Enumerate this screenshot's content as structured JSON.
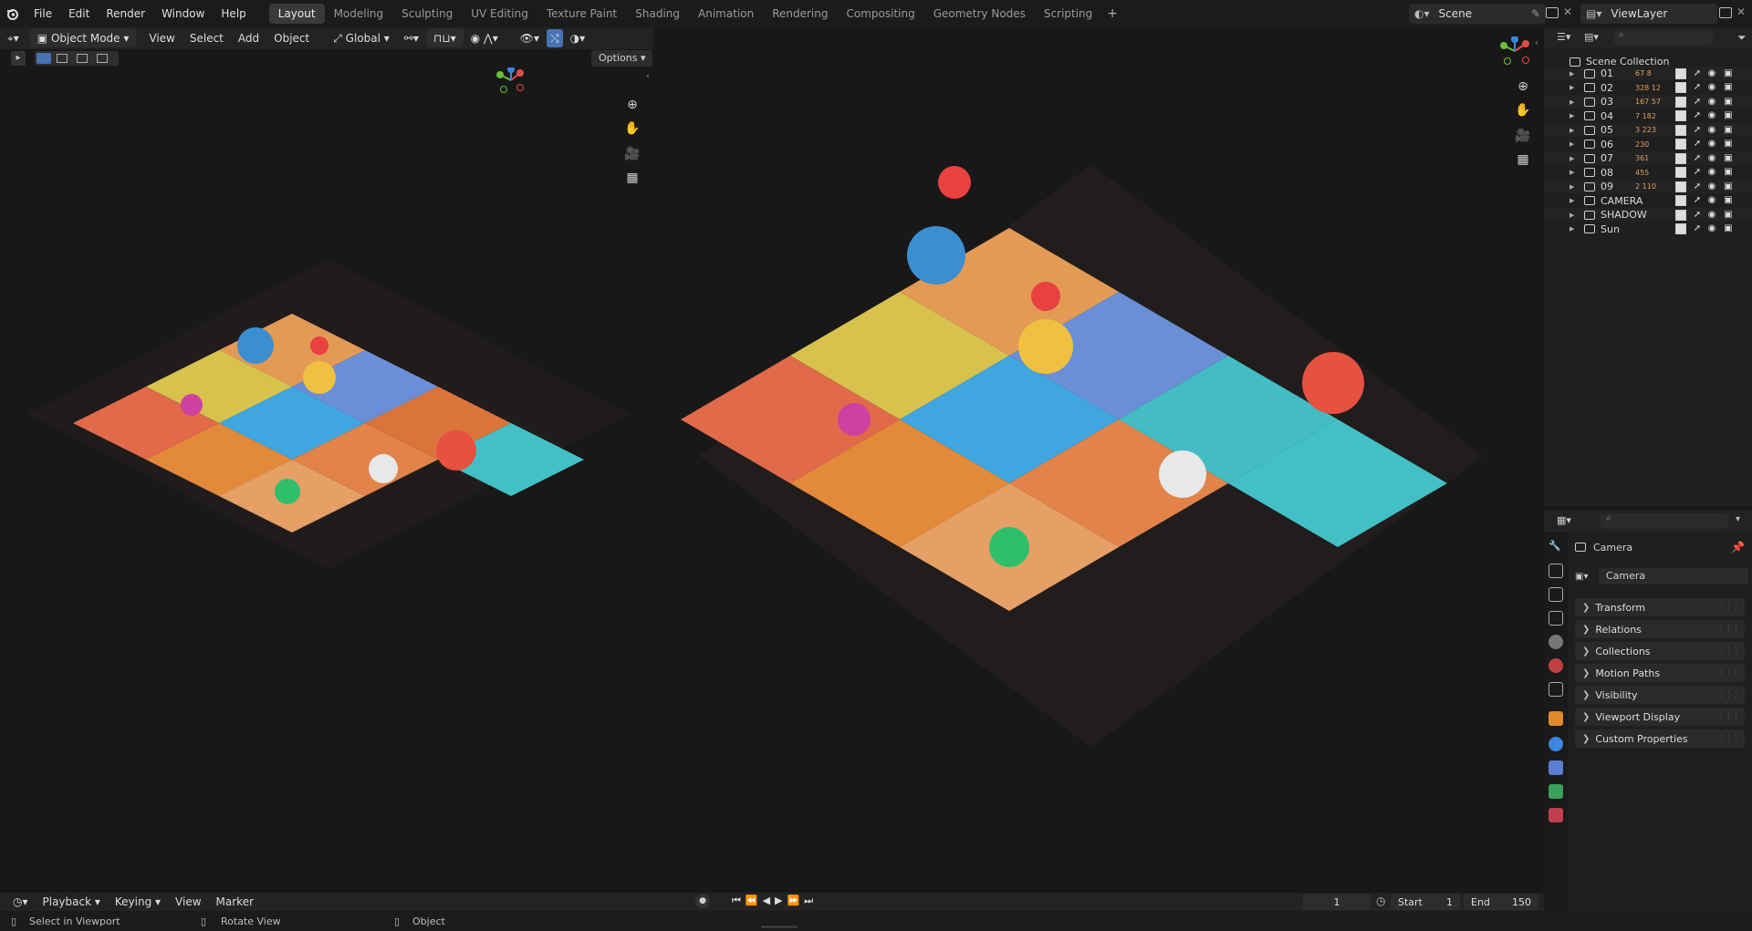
{
  "menu": [
    "File",
    "Edit",
    "Render",
    "Window",
    "Help"
  ],
  "workspaces": [
    "Layout",
    "Modeling",
    "Sculpting",
    "UV Editing",
    "Texture Paint",
    "Shading",
    "Animation",
    "Rendering",
    "Compositing",
    "Geometry Nodes",
    "Scripting"
  ],
  "active_workspace": "Layout",
  "scene_name": "Scene",
  "view_layer": "ViewLayer",
  "viewport_header": {
    "mode": "Object Mode",
    "menus": [
      "View",
      "Select",
      "Add",
      "Object"
    ],
    "orientation": "Global",
    "options_label": "Options"
  },
  "outliner": {
    "root": "Scene Collection",
    "items": [
      {
        "name": "01",
        "counts": [
          "67",
          "8"
        ]
      },
      {
        "name": "02",
        "counts": [
          "328",
          "12"
        ]
      },
      {
        "name": "03",
        "counts": [
          "167",
          "57"
        ]
      },
      {
        "name": "04",
        "counts": [
          "7",
          "182"
        ]
      },
      {
        "name": "05",
        "counts": [
          "3",
          "223"
        ]
      },
      {
        "name": "06",
        "counts": [
          "230"
        ]
      },
      {
        "name": "07",
        "counts": [
          "361"
        ]
      },
      {
        "name": "08",
        "counts": [
          "455"
        ]
      },
      {
        "name": "09",
        "counts": [
          "2",
          "110"
        ]
      },
      {
        "name": "CAMERA",
        "counts": []
      },
      {
        "name": "SHADOW",
        "counts": []
      },
      {
        "name": "Sun",
        "counts": []
      }
    ]
  },
  "properties": {
    "object_name": "Camera",
    "data_name": "Camera",
    "panels": [
      "Transform",
      "Relations",
      "Collections",
      "Motion Paths",
      "Visibility",
      "Viewport Display",
      "Custom Properties"
    ]
  },
  "timeline": {
    "menus": [
      "Playback",
      "Keying",
      "View",
      "Marker"
    ],
    "current_frame": "1",
    "start_label": "Start",
    "start": "1",
    "end_label": "End",
    "end": "150"
  },
  "status": {
    "left": "Select in Viewport",
    "middle": "Rotate View",
    "right": "Object"
  },
  "colors": {
    "accent_blue": "#4772b3",
    "axis_x": "#e44b4b",
    "axis_y": "#6bbd3c",
    "axis_z": "#3d86e0",
    "orange_object": "#e08a2c"
  }
}
